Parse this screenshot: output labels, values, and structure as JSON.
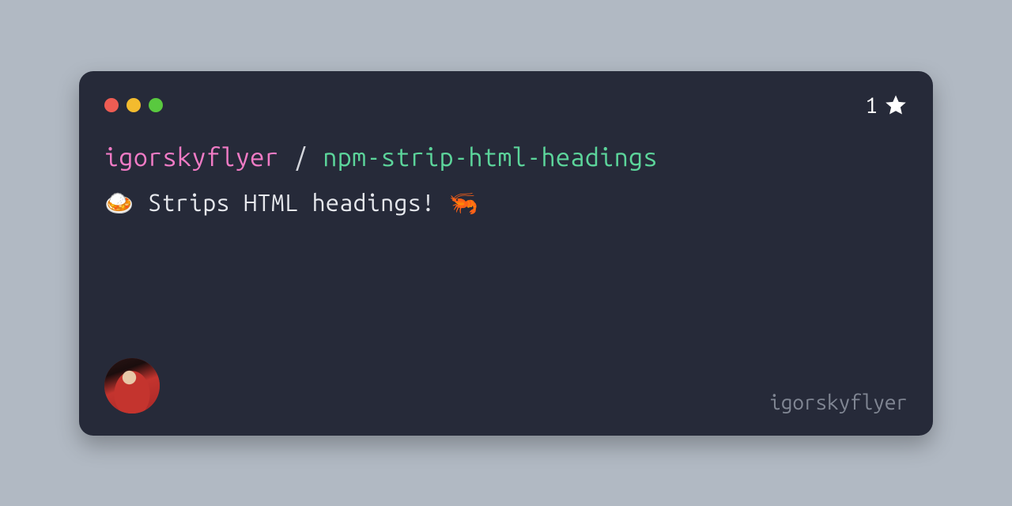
{
  "stars": {
    "count": "1"
  },
  "repo": {
    "owner": "igorskyflyer",
    "separator": " / ",
    "name": "npm-strip-html-headings"
  },
  "description": "🍛 Strips HTML headings! 🦐",
  "footer": {
    "username": "igorskyflyer"
  }
}
